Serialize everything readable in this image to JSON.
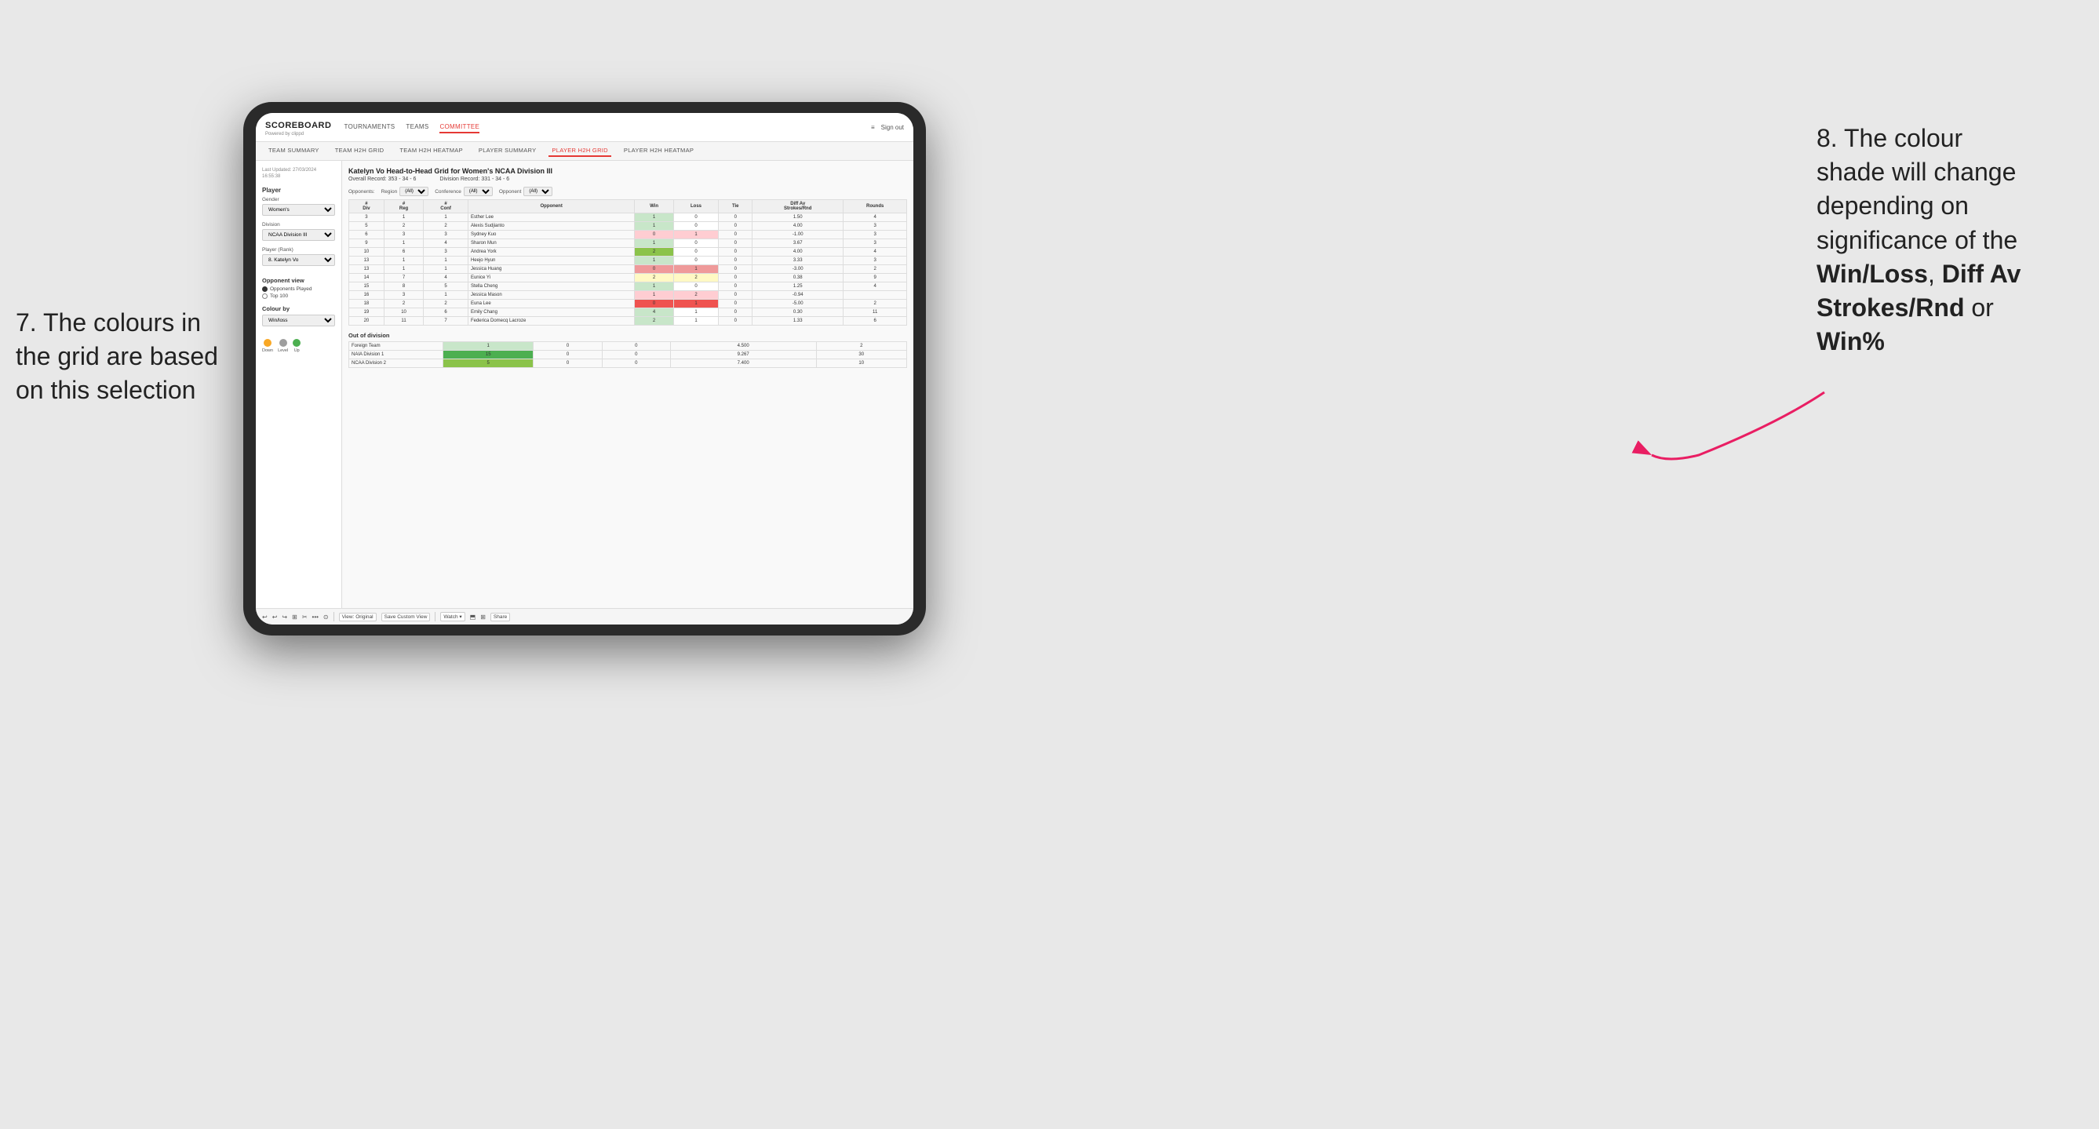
{
  "annotations": {
    "left_text_1": "7. The colours in",
    "left_text_2": "the grid are based",
    "left_text_3": "on this selection",
    "right_text_1": "8. The colour",
    "right_text_2": "shade will change",
    "right_text_3": "depending on",
    "right_text_4": "significance of the",
    "right_text_5_bold": "Win/Loss",
    "right_text_5_mid": ", ",
    "right_text_6_bold": "Diff Av",
    "right_text_7_bold": "Strokes/Rnd",
    "right_text_8_pre": " or",
    "right_text_9_bold": "Win%"
  },
  "nav": {
    "logo": "SCOREBOARD",
    "logo_sub": "Powered by clippd",
    "items": [
      "TOURNAMENTS",
      "TEAMS",
      "COMMITTEE"
    ],
    "active": "COMMITTEE",
    "right_icon": "≡",
    "sign_out": "Sign out"
  },
  "sub_nav": {
    "items": [
      "TEAM SUMMARY",
      "TEAM H2H GRID",
      "TEAM H2H HEATMAP",
      "PLAYER SUMMARY",
      "PLAYER H2H GRID",
      "PLAYER H2H HEATMAP"
    ],
    "active": "PLAYER H2H GRID"
  },
  "sidebar": {
    "last_updated_label": "Last Updated: 27/03/2024",
    "last_updated_time": "16:55:38",
    "player_section": "Player",
    "gender_label": "Gender",
    "gender_value": "Women's",
    "division_label": "Division",
    "division_value": "NCAA Division III",
    "player_rank_label": "Player (Rank)",
    "player_rank_value": "8. Katelyn Vo",
    "opponent_view_title": "Opponent view",
    "opponent_played": "Opponents Played",
    "top_100": "Top 100",
    "colour_by_title": "Colour by",
    "colour_by_value": "Win/loss",
    "legend_down": "Down",
    "legend_level": "Level",
    "legend_up": "Up"
  },
  "grid": {
    "title": "Katelyn Vo Head-to-Head Grid for Women's NCAA Division III",
    "overall_record_label": "Overall Record:",
    "overall_record_value": "353 - 34 - 6",
    "division_record_label": "Division Record:",
    "division_record_value": "331 - 34 - 6",
    "opponents_label": "Opponents:",
    "opponents_value": "(All)",
    "region_label": "Region",
    "conference_label": "Conference",
    "opponent_label": "Opponent",
    "col_headers": [
      "#\nDiv",
      "#\nReg",
      "#\nConf",
      "Opponent",
      "Win",
      "Loss",
      "Tie",
      "Diff Av\nStrokes/Rnd",
      "Rounds"
    ],
    "rows": [
      {
        "div": "3",
        "reg": "1",
        "conf": "1",
        "opponent": "Esther Lee",
        "win": 1,
        "loss": 0,
        "tie": 0,
        "diff": "1.50",
        "rounds": 4,
        "win_color": "green-light"
      },
      {
        "div": "5",
        "reg": "2",
        "conf": "2",
        "opponent": "Alexis Sudjianto",
        "win": 1,
        "loss": 0,
        "tie": 0,
        "diff": "4.00",
        "rounds": 3,
        "win_color": "green-light"
      },
      {
        "div": "6",
        "reg": "3",
        "conf": "3",
        "opponent": "Sydney Kuo",
        "win": 0,
        "loss": 1,
        "tie": 0,
        "diff": "-1.00",
        "rounds": 3,
        "win_color": "red-light"
      },
      {
        "div": "9",
        "reg": "1",
        "conf": "4",
        "opponent": "Sharon Mun",
        "win": 1,
        "loss": 0,
        "tie": 0,
        "diff": "3.67",
        "rounds": 3,
        "win_color": "green-light"
      },
      {
        "div": "10",
        "reg": "6",
        "conf": "3",
        "opponent": "Andrea York",
        "win": 2,
        "loss": 0,
        "tie": 0,
        "diff": "4.00",
        "rounds": 4,
        "win_color": "green-medium"
      },
      {
        "div": "13",
        "reg": "1",
        "conf": "1",
        "opponent": "Heejo Hyun",
        "win": 1,
        "loss": 0,
        "tie": 0,
        "diff": "3.33",
        "rounds": 3,
        "win_color": "green-light"
      },
      {
        "div": "13",
        "reg": "1",
        "conf": "1",
        "opponent": "Jessica Huang",
        "win": 0,
        "loss": 1,
        "tie": 0,
        "diff": "-3.00",
        "rounds": 2,
        "win_color": "red-medium"
      },
      {
        "div": "14",
        "reg": "7",
        "conf": "4",
        "opponent": "Eunice Yi",
        "win": 2,
        "loss": 2,
        "tie": 0,
        "diff": "0.38",
        "rounds": 9,
        "win_color": "yellow"
      },
      {
        "div": "15",
        "reg": "8",
        "conf": "5",
        "opponent": "Stella Cheng",
        "win": 1,
        "loss": 0,
        "tie": 0,
        "diff": "1.25",
        "rounds": 4,
        "win_color": "green-light"
      },
      {
        "div": "16",
        "reg": "3",
        "conf": "1",
        "opponent": "Jessica Mason",
        "win": 1,
        "loss": 2,
        "tie": 0,
        "diff": "-0.94",
        "rounds": "",
        "win_color": "red-light"
      },
      {
        "div": "18",
        "reg": "2",
        "conf": "2",
        "opponent": "Euna Lee",
        "win": 0,
        "loss": 1,
        "tie": 0,
        "diff": "-5.00",
        "rounds": 2,
        "win_color": "red-strong"
      },
      {
        "div": "19",
        "reg": "10",
        "conf": "6",
        "opponent": "Emily Chang",
        "win": 4,
        "loss": 1,
        "tie": 0,
        "diff": "0.30",
        "rounds": 11,
        "win_color": "green-light"
      },
      {
        "div": "20",
        "reg": "11",
        "conf": "7",
        "opponent": "Federica Domecq Lacroze",
        "win": 2,
        "loss": 1,
        "tie": 0,
        "diff": "1.33",
        "rounds": 6,
        "win_color": "green-light"
      }
    ],
    "out_of_division_title": "Out of division",
    "ood_rows": [
      {
        "opponent": "Foreign Team",
        "win": 1,
        "loss": 0,
        "tie": 0,
        "diff": "4.500",
        "rounds": 2,
        "win_color": "green-light"
      },
      {
        "opponent": "NAIA Division 1",
        "win": 15,
        "loss": 0,
        "tie": 0,
        "diff": "9.267",
        "rounds": 30,
        "win_color": "green-strong"
      },
      {
        "opponent": "NCAA Division 2",
        "win": 5,
        "loss": 0,
        "tie": 0,
        "diff": "7.400",
        "rounds": 10,
        "win_color": "green-medium"
      }
    ]
  },
  "toolbar": {
    "icons": [
      "↩",
      "↩",
      "↪",
      "⊞",
      "✂",
      "·",
      "⊙",
      "|"
    ],
    "view_original": "View: Original",
    "save_custom": "Save Custom View",
    "watch": "Watch ▾",
    "share": "Share"
  },
  "colors": {
    "accent": "#e53935",
    "green_strong": "#4caf50",
    "green_medium": "#8bc34a",
    "green_light": "#c8e6c9",
    "yellow": "#fff9c4",
    "red_light": "#ffcdd2",
    "red_medium": "#ef9a9a",
    "red_strong": "#ef5350",
    "legend_down": "#f9a825",
    "legend_level": "#9e9e9e",
    "legend_up": "#4caf50"
  }
}
